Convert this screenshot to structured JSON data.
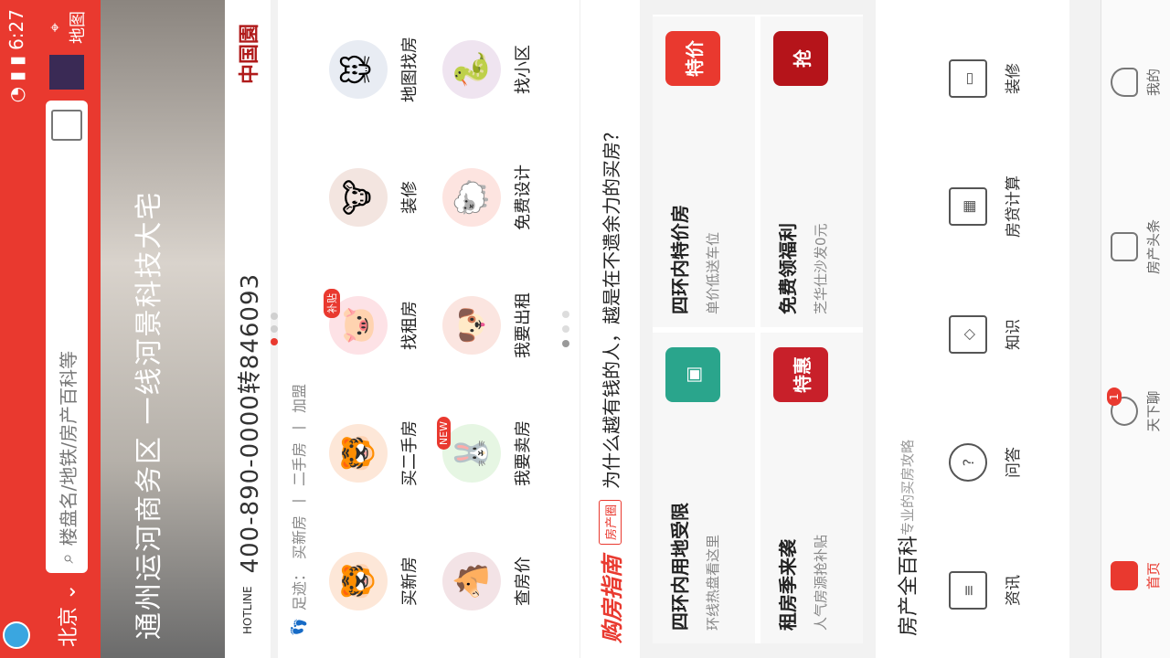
{
  "status_bar": {
    "time": "6:27"
  },
  "header": {
    "city": "北京",
    "search_placeholder": "楼盘名/地铁/房产百科等",
    "map_label": "地图"
  },
  "banner": {
    "slogan": "通州运河商务区 一线河景科技大宅",
    "hotline_label": "HOTLINE",
    "hotline_number": "400-890-0000转846093",
    "project_logo": "中国園"
  },
  "footprint": {
    "label": "足迹：",
    "items": [
      "买新房",
      "二手房",
      "加盟"
    ]
  },
  "services": [
    {
      "label": "买新房",
      "icon": "🐯"
    },
    {
      "label": "买二手房",
      "icon": "🐯"
    },
    {
      "label": "找租房",
      "icon": "🐷",
      "badge": "补贴"
    },
    {
      "label": "装修",
      "icon": "🐮"
    },
    {
      "label": "地图找房",
      "icon": "🐭"
    },
    {
      "label": "查房价",
      "icon": "🐴"
    },
    {
      "label": "我要卖房",
      "icon": "🐰",
      "badge": "NEW"
    },
    {
      "label": "我要出租",
      "icon": "🐶"
    },
    {
      "label": "免费设计",
      "icon": "🐑"
    },
    {
      "label": "找小区",
      "icon": "🐍"
    }
  ],
  "guide": {
    "title": "购房指南",
    "tag": "房产圈",
    "text": "为什么越有钱的人，越是在不遗余力的买房？"
  },
  "deals": [
    {
      "title": "四环内用地受限",
      "subtitle": "环线热盘看这里",
      "color": "#2aa58c",
      "img": ""
    },
    {
      "title": "四环内特价房",
      "subtitle": "单价低送车位",
      "color": "#e9392f",
      "img": "特价"
    },
    {
      "title": "租房季来袭",
      "subtitle": "人气房源抢补贴",
      "color": "#c8202a",
      "img": "特惠"
    },
    {
      "title": "免费领福利",
      "subtitle": "芝华仕沙发0元",
      "color": "#b5141a",
      "img": "抢"
    }
  ],
  "wiki": {
    "title": "房产全百科",
    "subtitle": "专业的买房攻略",
    "items": [
      {
        "label": "资讯",
        "icon": "≡"
      },
      {
        "label": "问答",
        "icon": "?"
      },
      {
        "label": "知识",
        "icon": "◇"
      },
      {
        "label": "房贷计算",
        "icon": "▦"
      },
      {
        "label": "装修",
        "icon": "▭"
      }
    ]
  },
  "tabbar": [
    {
      "label": "首页",
      "active": true
    },
    {
      "label": "天下聊",
      "badge": "1"
    },
    {
      "label": "房产头条"
    },
    {
      "label": "我的"
    }
  ]
}
